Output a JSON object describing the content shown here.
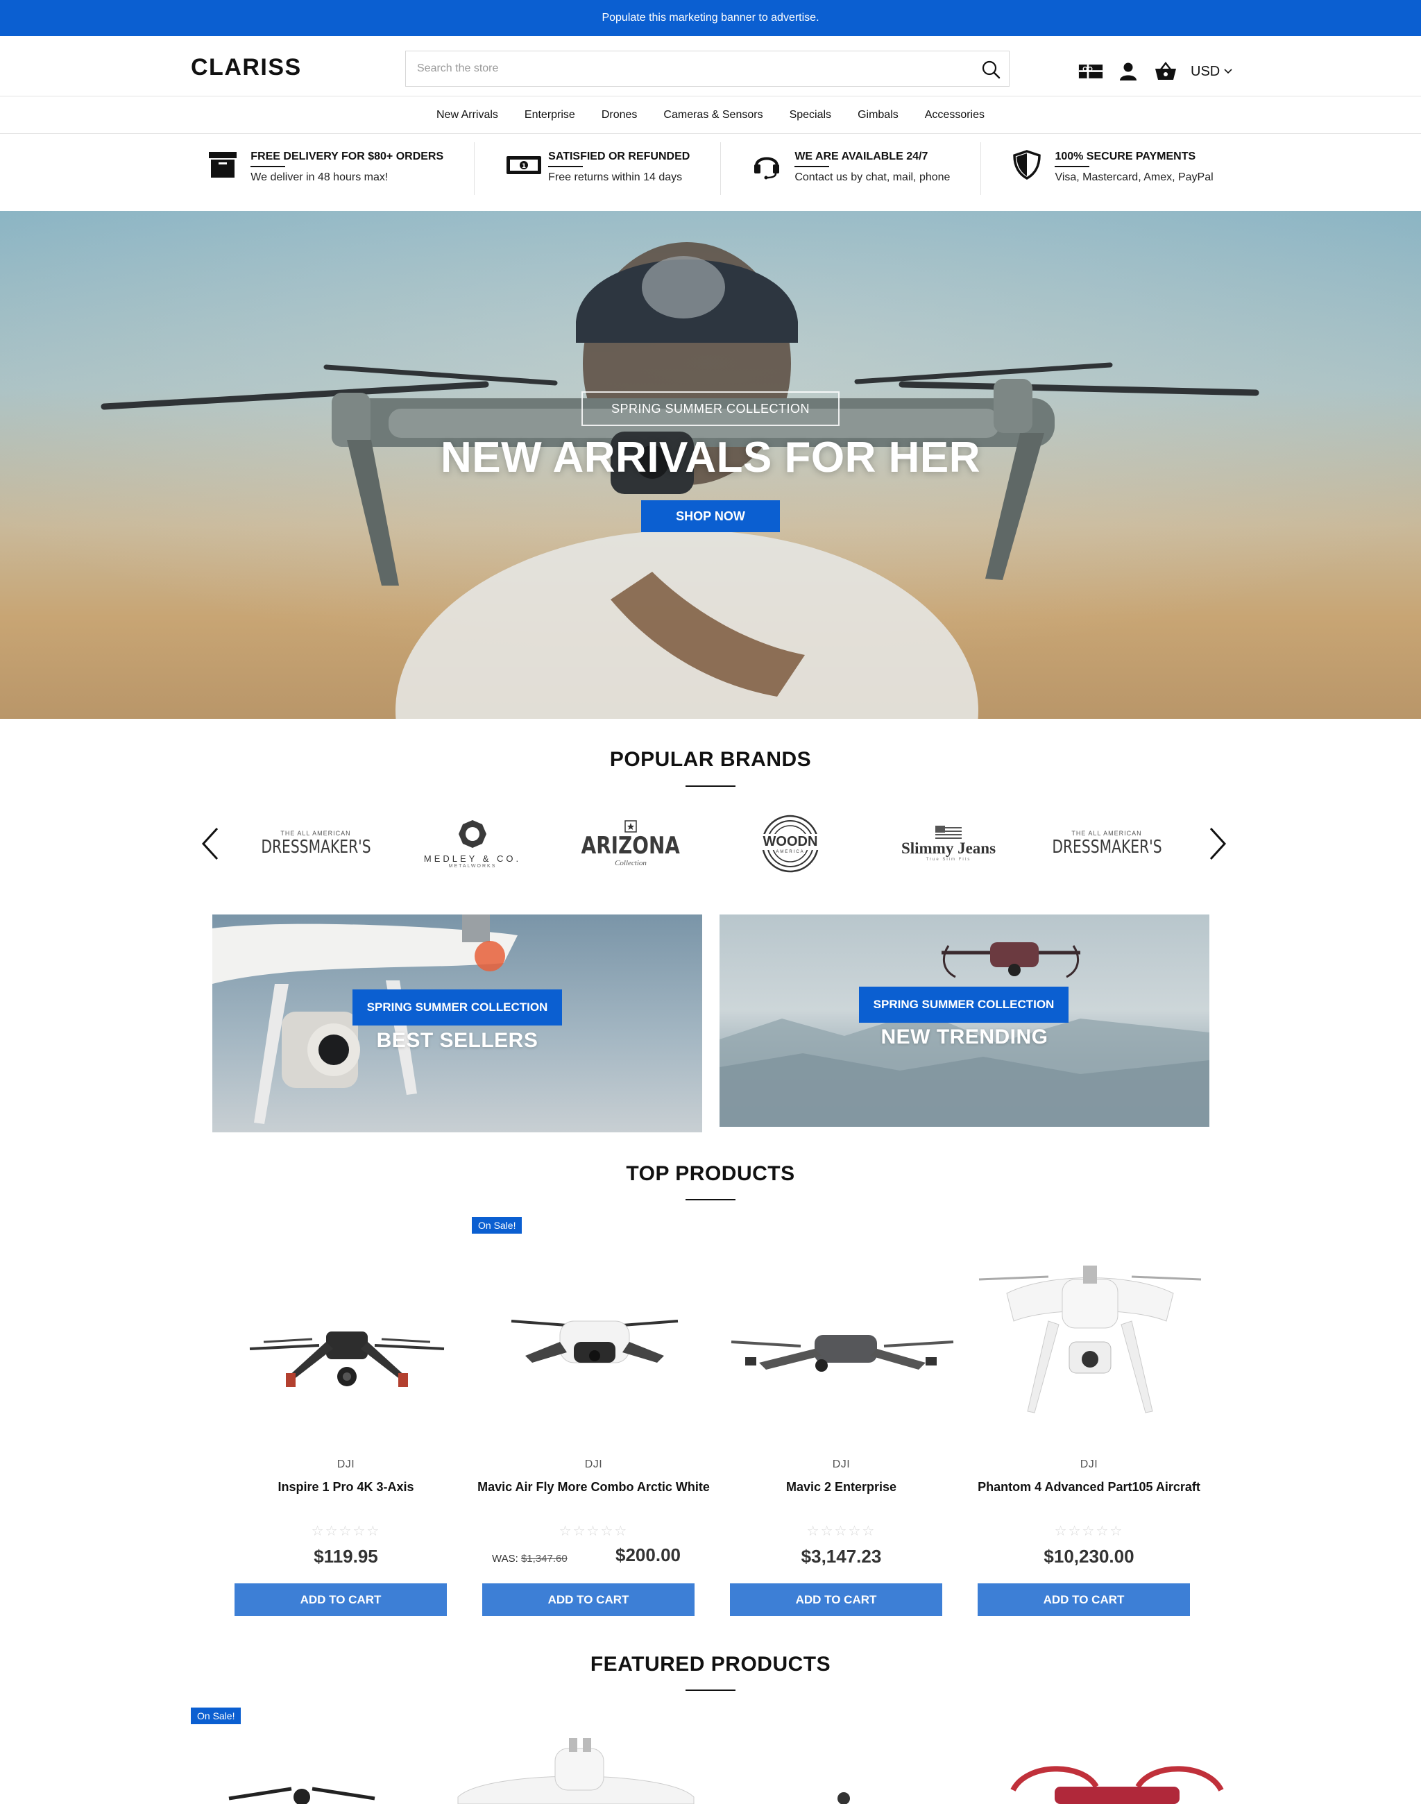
{
  "promo_banner": {
    "text": "Populate this marketing banner to advertise."
  },
  "header": {
    "logo": "CLARISS",
    "search_placeholder": "Search the store",
    "currency": "USD",
    "icons": [
      "gift-card-icon",
      "user-icon",
      "basket-icon",
      "chevron-down-icon"
    ]
  },
  "nav": {
    "items": [
      "New Arrivals",
      "Enterprise",
      "Drones",
      "Cameras & Sensors",
      "Specials",
      "Gimbals",
      "Accessories"
    ]
  },
  "features": [
    {
      "title": "FREE DELIVERY FOR $80+ ORDERS",
      "desc": "We deliver in 48 hours max!",
      "icon": "archive-box-icon"
    },
    {
      "title": "SATISFIED OR REFUNDED",
      "desc": "Free returns within 14 days",
      "icon": "banknote-icon"
    },
    {
      "title": "WE ARE AVAILABLE 24/7",
      "desc": "Contact us by chat, mail, phone",
      "icon": "headset-icon"
    },
    {
      "title": "100% SECURE PAYMENTS",
      "desc": "Visa, Mastercard, Amex, PayPal",
      "icon": "shield-icon"
    }
  ],
  "hero": {
    "tag": "SPRING SUMMER COLLECTION",
    "title": "NEW ARRIVALS FOR HER",
    "button": "SHOP NOW"
  },
  "popular_brands": {
    "title": "POPULAR BRANDS",
    "brands": [
      "DRESSMAKER'S",
      "MEDLEY & CO.",
      "ARIZONA",
      "WOODN",
      "Slimmy Jeans",
      "DRESSMAKER'S"
    ],
    "brand_sublabels": {
      "dressmakers": "THE ALL AMERICAN",
      "medley": "METALWORKS",
      "arizona": "Collection",
      "woodn": "AMERICA",
      "slimmy": "True Slim Fits"
    }
  },
  "banners": [
    {
      "tag": "SPRING SUMMER COLLECTION",
      "title": "BEST SELLERS"
    },
    {
      "tag": "SPRING SUMMER COLLECTION",
      "title": "NEW TRENDING"
    }
  ],
  "top_products": {
    "title": "TOP PRODUCTS",
    "items": [
      {
        "brand": "DJI",
        "name": "Inspire 1 Pro 4K 3-Axis",
        "price": "$119.95",
        "rating": "☆☆☆☆☆",
        "button": "ADD TO CART"
      },
      {
        "brand": "DJI",
        "name": "Mavic Air Fly More Combo Arctic White",
        "was_label": "WAS:",
        "was_price": "$1,347.60",
        "price": "$200.00",
        "rating": "☆☆☆☆☆",
        "badge": "On Sale!",
        "button": "ADD TO CART"
      },
      {
        "brand": "DJI",
        "name": "Mavic 2 Enterprise",
        "price": "$3,147.23",
        "rating": "☆☆☆☆☆",
        "button": "ADD TO CART"
      },
      {
        "brand": "DJI",
        "name": "Phantom 4 Advanced Part105 Aircraft",
        "price": "$10,230.00",
        "rating": "☆☆☆☆☆",
        "button": "ADD TO CART"
      }
    ]
  },
  "featured_products": {
    "title": "FEATURED PRODUCTS",
    "badge": "On Sale!"
  },
  "colors": {
    "accent": "#0b5fd1",
    "cart_button": "#3d7fd6"
  }
}
